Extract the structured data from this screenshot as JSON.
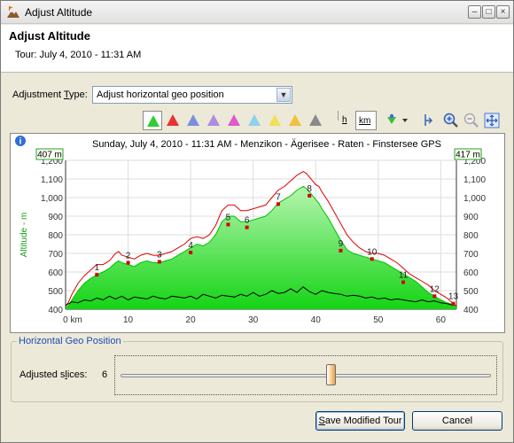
{
  "window": {
    "title": "Adjust Altitude",
    "header_title": "Adjust Altitude",
    "header_subtitle": "Tour: July 4, 2010 - 11:31 AM"
  },
  "adjustment": {
    "label_prefix": "Adjustment ",
    "label_mnemonic": "T",
    "label_suffix": "ype:",
    "selected": "Adjust horizontal geo position"
  },
  "toolbar": {
    "graph_colors": [
      "#33cc33",
      "#e83232",
      "#7b8fe0",
      "#b08be0",
      "#e05ac8",
      "#8fd0ef",
      "#f0e05a",
      "#f0c040",
      "#8a8a8a"
    ],
    "unit_h": "h",
    "unit_km": "km"
  },
  "chart_data": {
    "type": "area",
    "title": "Sunday, July 4, 2010 - 11:31 AM - Menzikon - Ägerisee - Raten - Finstersee GPS",
    "xlabel": "",
    "ylabel": "Altitude - m",
    "x_unit_label": "0 km",
    "xlim": [
      0,
      62.5
    ],
    "ylim": [
      400,
      1200
    ],
    "x_ticks": [
      0,
      10,
      20,
      30,
      40,
      50,
      60
    ],
    "y_ticks": [
      400,
      500,
      600,
      700,
      800,
      900,
      1000,
      1100,
      1200
    ],
    "y_tick_labels": [
      "400",
      "500",
      "600",
      "700",
      "800",
      "900",
      "1,000",
      "1,100",
      "1,200"
    ],
    "start_label": "407 m",
    "end_label": "417 m",
    "grid": true,
    "series": [
      {
        "color": "#e00000",
        "x": [
          0,
          0.5,
          1,
          2,
          3,
          4,
          5,
          6,
          7,
          8,
          8.5,
          9,
          10,
          11,
          12,
          13,
          14,
          15,
          16,
          17,
          18,
          19,
          20,
          21,
          22,
          23,
          24,
          25,
          26,
          27,
          28,
          29,
          30,
          31,
          32,
          33,
          34,
          35,
          36,
          37,
          37.5,
          38,
          38.5,
          39,
          39.5,
          40,
          40.5,
          41,
          42,
          43,
          44,
          45,
          46,
          47,
          48,
          49,
          50,
          51,
          52,
          53,
          54,
          55,
          56,
          57,
          58,
          59,
          60,
          61,
          62,
          62.5
        ],
        "y": [
          415,
          440,
          480,
          540,
          580,
          610,
          640,
          640,
          660,
          700,
          710,
          690,
          680,
          670,
          690,
          700,
          690,
          690,
          700,
          710,
          730,
          750,
          780,
          790,
          780,
          800,
          850,
          930,
          960,
          960,
          930,
          930,
          940,
          950,
          960,
          1000,
          1040,
          1060,
          1090,
          1120,
          1130,
          1140,
          1130,
          1110,
          1090,
          1070,
          1060,
          1030,
          980,
          920,
          860,
          800,
          760,
          730,
          710,
          700,
          700,
          690,
          670,
          650,
          620,
          590,
          570,
          550,
          530,
          500,
          480,
          460,
          430,
          417
        ]
      },
      {
        "name": "Altitude",
        "color": "#00c000",
        "x": [
          0,
          0.5,
          1,
          2,
          3,
          4,
          5,
          6,
          7,
          8,
          8.5,
          9,
          10,
          11,
          12,
          13,
          14,
          15,
          16,
          17,
          18,
          19,
          20,
          21,
          22,
          23,
          24,
          25,
          26,
          27,
          28,
          29,
          30,
          31,
          32,
          33,
          34,
          35,
          36,
          37,
          37.5,
          38,
          38.5,
          39,
          39.5,
          40,
          40.5,
          41,
          42,
          43,
          44,
          45,
          46,
          47,
          48,
          49,
          50,
          51,
          52,
          53,
          54,
          55,
          56,
          57,
          58,
          59,
          60,
          61,
          62,
          62.5
        ],
        "y": [
          407,
          420,
          450,
          500,
          540,
          565,
          585,
          600,
          620,
          650,
          660,
          650,
          640,
          630,
          650,
          660,
          650,
          650,
          660,
          670,
          690,
          710,
          730,
          750,
          740,
          760,
          800,
          870,
          900,
          900,
          870,
          870,
          880,
          890,
          900,
          930,
          970,
          990,
          1010,
          1040,
          1050,
          1060,
          1050,
          1030,
          1010,
          990,
          970,
          940,
          890,
          830,
          770,
          720,
          700,
          690,
          680,
          670,
          660,
          650,
          630,
          610,
          590,
          570,
          550,
          520,
          490,
          470,
          450,
          435,
          425,
          417
        ]
      },
      {
        "color": "#000000",
        "x": [
          0,
          1,
          2,
          3,
          4,
          5,
          6,
          7,
          8,
          9,
          10,
          11,
          12,
          13,
          14,
          15,
          16,
          17,
          18,
          19,
          20,
          21,
          22,
          23,
          24,
          25,
          26,
          27,
          28,
          29,
          30,
          31,
          32,
          33,
          34,
          35,
          36,
          37,
          38,
          39,
          40,
          41,
          42,
          43,
          44,
          45,
          46,
          47,
          48,
          49,
          50,
          51,
          52,
          53,
          54,
          55,
          56,
          57,
          58,
          59,
          60,
          61,
          62
        ],
        "y": [
          420,
          440,
          435,
          450,
          445,
          460,
          450,
          470,
          455,
          470,
          450,
          465,
          460,
          455,
          470,
          460,
          455,
          470,
          465,
          460,
          470,
          455,
          480,
          470,
          460,
          475,
          470,
          465,
          480,
          470,
          490,
          470,
          480,
          500,
          485,
          490,
          510,
          490,
          520,
          495,
          480,
          500,
          490,
          485,
          480,
          470,
          475,
          470,
          460,
          465,
          455,
          460,
          450,
          455,
          450,
          445,
          440,
          450,
          440,
          445,
          435,
          430,
          420
        ]
      }
    ],
    "markers": [
      {
        "label": "1",
        "x": 5,
        "y": 585
      },
      {
        "label": "2",
        "x": 10,
        "y": 650
      },
      {
        "label": "3",
        "x": 15,
        "y": 655
      },
      {
        "label": "4",
        "x": 20,
        "y": 705
      },
      {
        "label": "5",
        "x": 26,
        "y": 855
      },
      {
        "label": "6",
        "x": 29,
        "y": 840
      },
      {
        "label": "7",
        "x": 34,
        "y": 965
      },
      {
        "label": "8",
        "x": 39,
        "y": 1010
      },
      {
        "label": "9",
        "x": 44,
        "y": 715
      },
      {
        "label": "10",
        "x": 49,
        "y": 670
      },
      {
        "label": "11",
        "x": 54,
        "y": 545
      },
      {
        "label": "12",
        "x": 59,
        "y": 470
      },
      {
        "label": "13",
        "x": 62,
        "y": 430
      }
    ]
  },
  "geo_position": {
    "group_title": "Horizontal Geo Position",
    "slices_label_prefix": "Adjusted s",
    "slices_label_mnemonic": "l",
    "slices_label_suffix": "ices:",
    "slices_value": "6",
    "slider_fraction": 0.57
  },
  "buttons": {
    "save_mnemonic": "S",
    "save_rest": "ave Modified Tour",
    "cancel": "Cancel"
  }
}
